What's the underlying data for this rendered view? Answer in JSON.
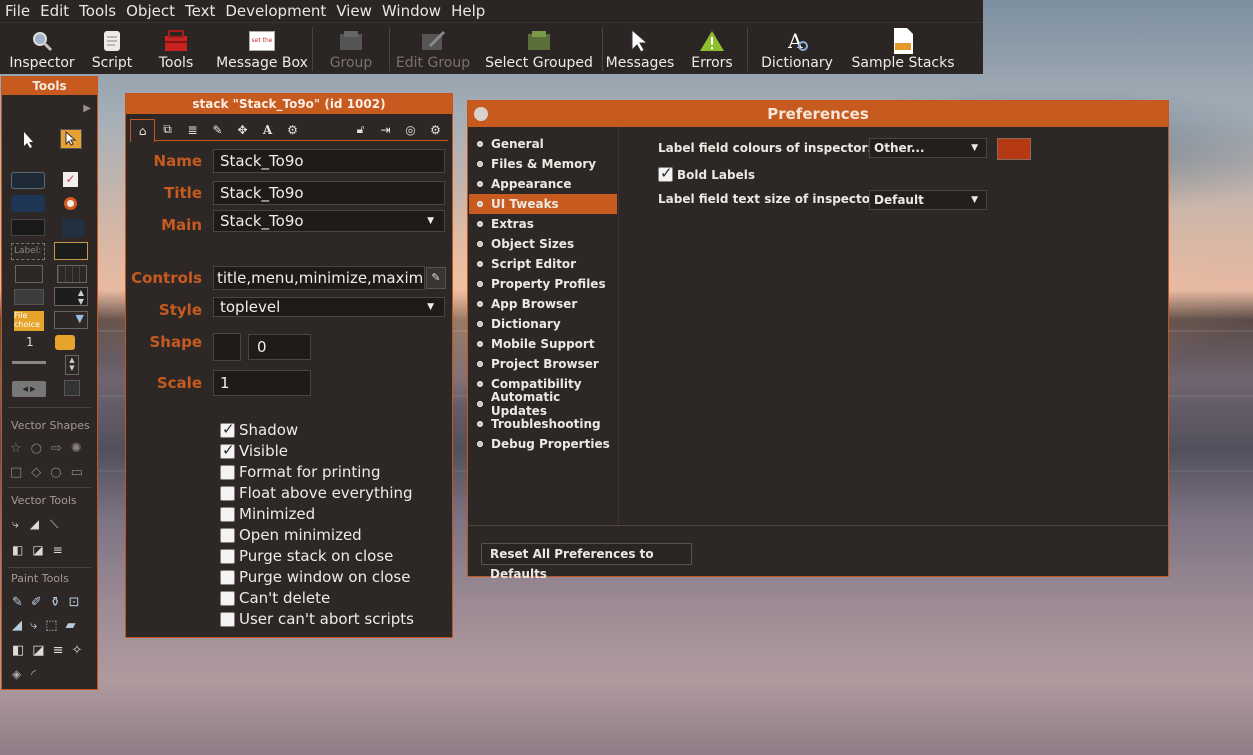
{
  "menubar": [
    "File",
    "Edit",
    "Tools",
    "Object",
    "Text",
    "Development",
    "View",
    "Window",
    "Help"
  ],
  "toolbar": {
    "items": [
      {
        "label": "Inspector",
        "icon": "magnifier-icon",
        "enabled": true
      },
      {
        "label": "Script",
        "icon": "scroll-icon",
        "enabled": true
      },
      {
        "label": "Tools",
        "icon": "toolbox-icon",
        "enabled": true
      },
      {
        "label": "Message Box",
        "icon": "message-box-icon",
        "enabled": true
      },
      {
        "label": "Group",
        "icon": "group-icon",
        "enabled": false
      },
      {
        "label": "Edit Group",
        "icon": "edit-group-icon",
        "enabled": false
      },
      {
        "label": "Select Grouped",
        "icon": "select-grouped-icon",
        "enabled": true
      },
      {
        "label": "Messages",
        "icon": "cursor-icon",
        "enabled": true
      },
      {
        "label": "Errors",
        "icon": "warning-icon",
        "enabled": true
      },
      {
        "label": "Dictionary",
        "icon": "dictionary-icon",
        "enabled": true
      },
      {
        "label": "Sample Stacks",
        "icon": "sample-stacks-icon",
        "enabled": true
      }
    ],
    "message_box_icon_text": "set the"
  },
  "tools_palette": {
    "title": "Tools",
    "label_tool_text": "Label:",
    "file_choice_text_1": "File",
    "file_choice_text_2": "choice",
    "number_tool_text": "1",
    "sections": {
      "vector_shapes": "Vector Shapes",
      "vector_tools": "Vector Tools",
      "paint_tools": "Paint Tools"
    }
  },
  "inspector": {
    "title": "stack \"Stack_To9o\" (id 1002)",
    "fields": {
      "name_label": "Name",
      "name_value": "Stack_To9o",
      "title_label": "Title",
      "title_value": "Stack_To9o",
      "main_label": "Main",
      "main_value": "Stack_To9o",
      "controls_label": "Controls",
      "controls_value": "title,menu,minimize,maximize,",
      "style_label": "Style",
      "style_value": "toplevel",
      "shape_label": "Shape",
      "shape_value": "0",
      "scale_label": "Scale",
      "scale_value": "1"
    },
    "checkboxes": [
      {
        "label": "Shadow",
        "checked": true
      },
      {
        "label": "Visible",
        "checked": true
      },
      {
        "label": "Format for printing",
        "checked": false
      },
      {
        "label": "Float above everything",
        "checked": false
      },
      {
        "label": "Minimized",
        "checked": false
      },
      {
        "label": "Open minimized",
        "checked": false
      },
      {
        "label": "Purge stack on close",
        "checked": false
      },
      {
        "label": "Purge window on close",
        "checked": false
      },
      {
        "label": "Can't delete",
        "checked": false
      },
      {
        "label": "User can't abort scripts",
        "checked": false
      }
    ]
  },
  "preferences": {
    "title": "Preferences",
    "sidebar": [
      "General",
      "Files & Memory",
      "Appearance",
      "UI Tweaks",
      "Extras",
      "Object Sizes",
      "Script Editor",
      "Property Profiles",
      "App Browser",
      "Dictionary",
      "Mobile Support",
      "Project Browser",
      "Compatibility",
      "Automatic Updates",
      "Troubleshooting",
      "Debug Properties"
    ],
    "active_index": 3,
    "label_colours_label": "Label field colours of inspector:",
    "label_colours_value": "Other...",
    "label_colour_swatch": "#b53a14",
    "bold_labels_label": "Bold Labels",
    "bold_labels_checked": true,
    "text_size_label": "Label field text size of inspector:",
    "text_size_value": "Default",
    "reset_button": "Reset All Preferences to Defaults"
  },
  "colors": {
    "accent": "#c65a1f",
    "panel": "#2d2826",
    "menubar": "#2b2623"
  }
}
